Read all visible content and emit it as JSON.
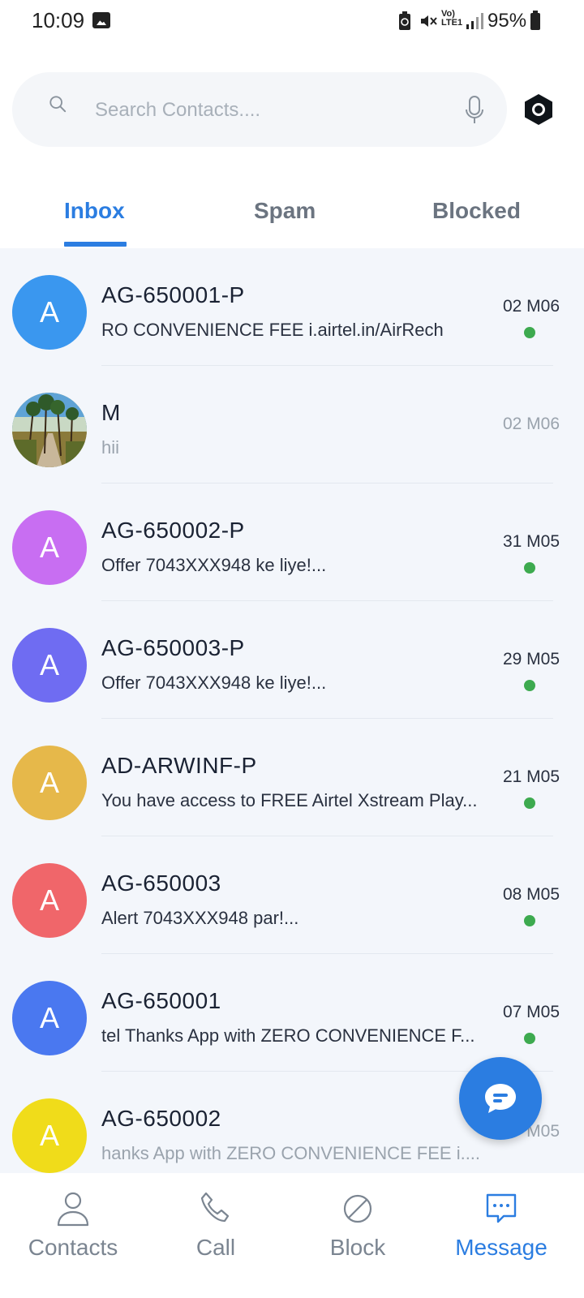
{
  "status_bar": {
    "time": "10:09",
    "network_label": "Vo) LTE1",
    "battery": "95%"
  },
  "search": {
    "placeholder": "Search Contacts...."
  },
  "tabs": [
    {
      "label": "Inbox",
      "active": true
    },
    {
      "label": "Spam",
      "active": false
    },
    {
      "label": "Blocked",
      "active": false
    }
  ],
  "messages": [
    {
      "initial": "A",
      "avatar_color": "#3a97ef",
      "name": "AG-650001-P",
      "preview": "RO CONVENIENCE FEE  i.airtel.in/AirRech",
      "date": "02 M06",
      "unread": true
    },
    {
      "initial": "",
      "avatar_color": "#6a8a5a",
      "avatar_type": "photo",
      "name": "M",
      "preview": "hii",
      "date": "02 M06",
      "unread": false
    },
    {
      "initial": "A",
      "avatar_color": "#c86ef2",
      "name": "AG-650002-P",
      "preview": "Offer 7043XXX948 ke liye!...",
      "date": "31 M05",
      "unread": true
    },
    {
      "initial": "A",
      "avatar_color": "#6f6cf2",
      "name": "AG-650003-P",
      "preview": "Offer 7043XXX948 ke liye!...",
      "date": "29 M05",
      "unread": true
    },
    {
      "initial": "A",
      "avatar_color": "#e6b84a",
      "name": "AD-ARWINF-P",
      "preview": "You have access to FREE Airtel Xstream Play...",
      "date": "21 M05",
      "unread": true
    },
    {
      "initial": "A",
      "avatar_color": "#f0666a",
      "name": "AG-650003",
      "preview": "Alert 7043XXX948 par!...",
      "date": "08 M05",
      "unread": true
    },
    {
      "initial": "A",
      "avatar_color": "#4a78f0",
      "name": "AG-650001",
      "preview": "tel Thanks App with ZERO CONVENIENCE F...",
      "date": "07 M05",
      "unread": true
    },
    {
      "initial": "A",
      "avatar_color": "#f0dc1a",
      "name": "AG-650002",
      "preview": "hanks App with ZERO CONVENIENCE FEE  i....",
      "date": "M05",
      "unread": false
    }
  ],
  "bottom_nav": [
    {
      "label": "Contacts",
      "icon": "person-icon",
      "active": false
    },
    {
      "label": "Call",
      "icon": "phone-icon",
      "active": false
    },
    {
      "label": "Block",
      "icon": "block-icon",
      "active": false
    },
    {
      "label": "Message",
      "icon": "message-icon",
      "active": true
    }
  ],
  "colors": {
    "accent": "#2b7de1",
    "unread_dot": "#3daa4f",
    "list_background": "#f3f6fb"
  }
}
